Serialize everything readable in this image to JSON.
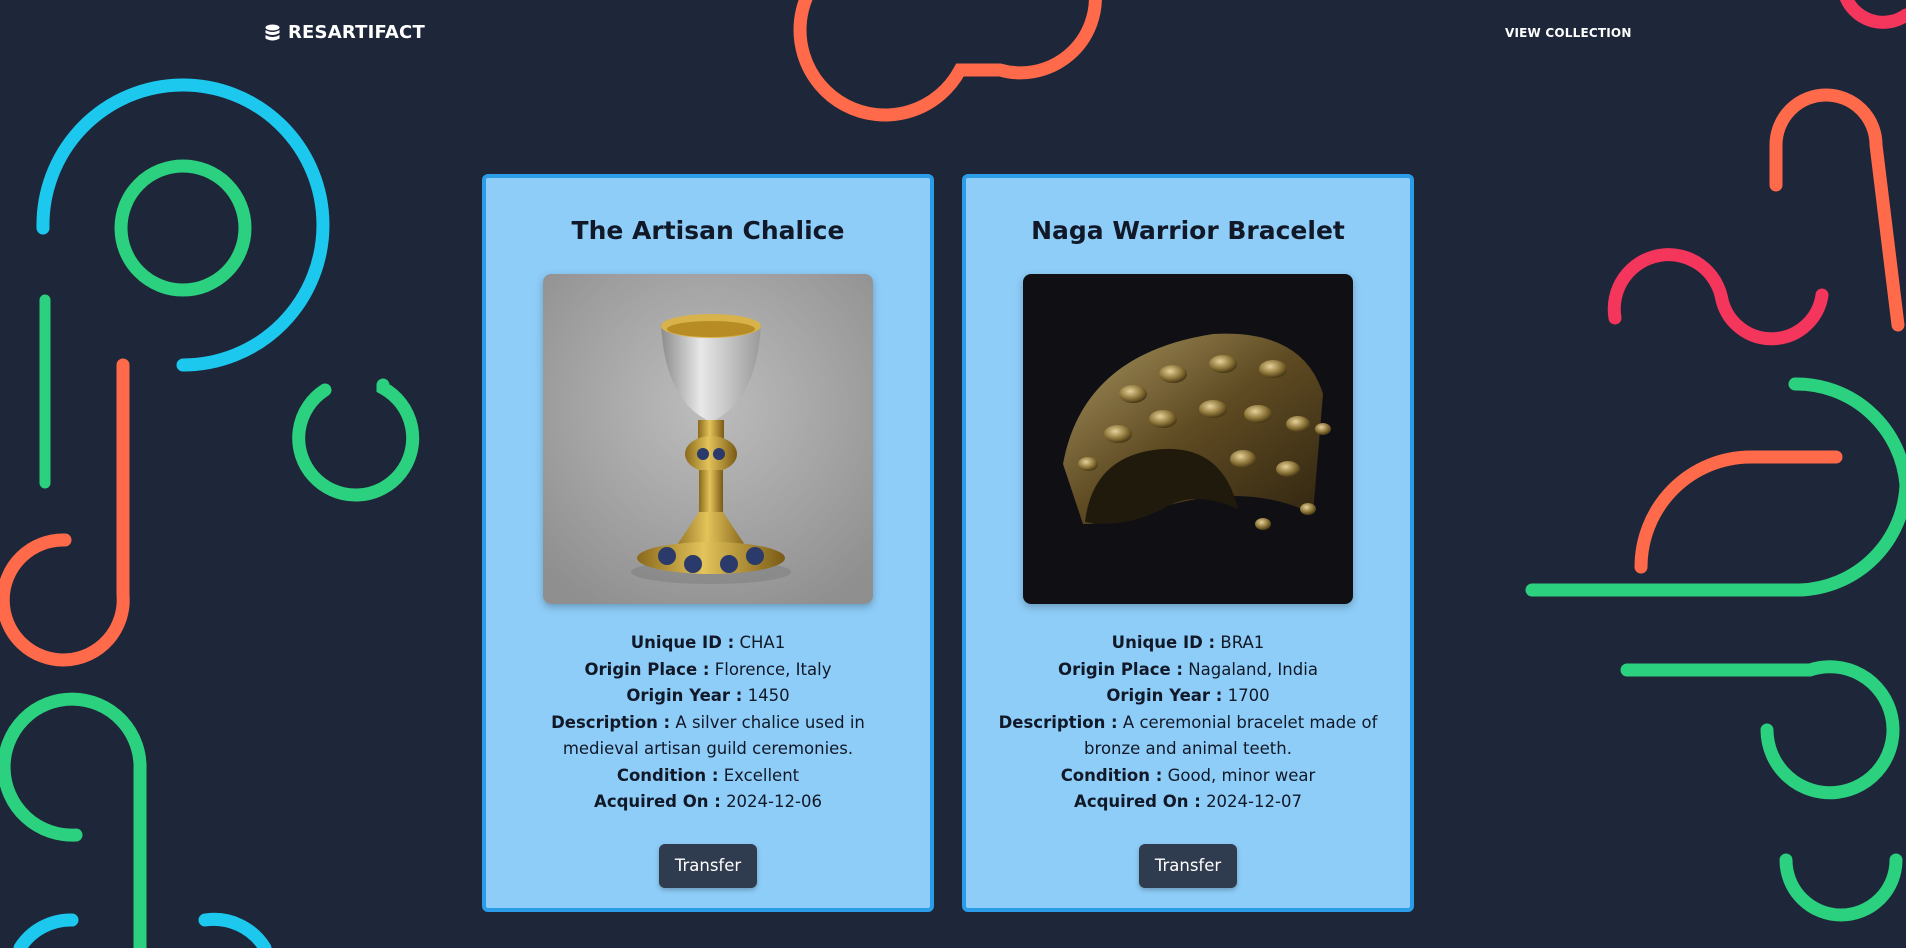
{
  "nav": {
    "brand": "RESARTIFACT",
    "brand_icon": "database-icon",
    "link": "VIEW COLLECTION"
  },
  "colors": {
    "background": "#1e2639",
    "card": "#8ecdf8",
    "card_border": "#2a9ce8",
    "button": "#2f3b4f",
    "deco_cyan": "#1cc8ee",
    "deco_green": "#2bd17e",
    "deco_orange": "#ff6b4a",
    "deco_red": "#f5365c"
  },
  "labels": {
    "unique_id": "Unique ID :",
    "origin_place": "Origin Place :",
    "origin_year": "Origin Year :",
    "description": "Description :",
    "condition": "Condition :",
    "acquired_on": "Acquired On :"
  },
  "artifacts": [
    {
      "title": "The Artisan Chalice",
      "image": "silver-gilt-chalice-image",
      "unique_id": "CHA1",
      "origin_place": "Florence, Italy",
      "origin_year": "1450",
      "description": "A silver chalice used in medieval artisan guild ceremonies.",
      "condition": "Excellent",
      "acquired_on": "2024-12-06",
      "button": "Transfer"
    },
    {
      "title": "Naga Warrior Bracelet",
      "image": "bronze-bracelet-image",
      "unique_id": "BRA1",
      "origin_place": "Nagaland, India",
      "origin_year": "1700",
      "description": "A ceremonial bracelet made of bronze and animal teeth.",
      "condition": "Good, minor wear",
      "acquired_on": "2024-12-07",
      "button": "Transfer"
    }
  ]
}
